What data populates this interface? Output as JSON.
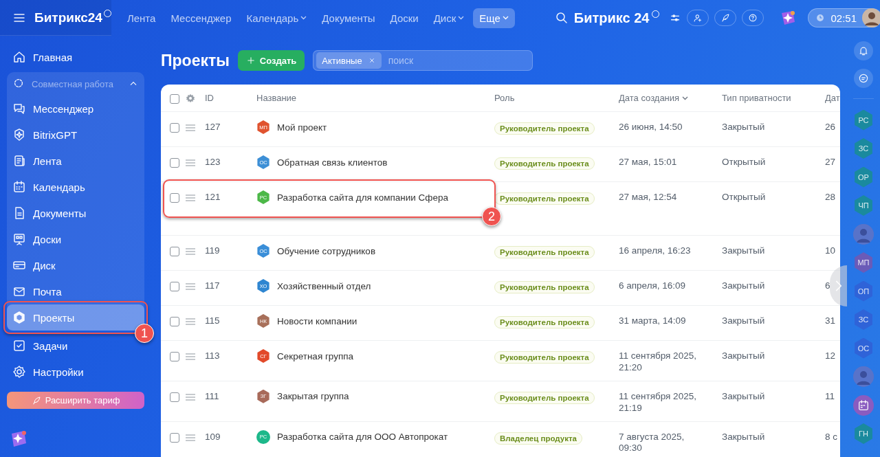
{
  "topbar": {
    "logo": "Битрикс24",
    "nav": [
      {
        "label": "Лента",
        "dropdown": false,
        "selected": false
      },
      {
        "label": "Мессенджер",
        "dropdown": false,
        "selected": false
      },
      {
        "label": "Календарь",
        "dropdown": true,
        "selected": false
      },
      {
        "label": "Документы",
        "dropdown": false,
        "selected": false
      },
      {
        "label": "Доски",
        "dropdown": false,
        "selected": false
      },
      {
        "label": "Диск",
        "dropdown": true,
        "selected": false
      },
      {
        "label": "Еще",
        "dropdown": true,
        "selected": true
      }
    ],
    "portal_title": "Битрикс 24",
    "time": "02:51"
  },
  "sidebar": {
    "top_items": [
      {
        "label": "Главная",
        "selected": false
      }
    ],
    "group": {
      "title": "Совместная работа",
      "expanded": true,
      "items": [
        {
          "label": "Мессенджер",
          "selected": false
        },
        {
          "label": "BitrixGPT",
          "selected": false
        },
        {
          "label": "Лента",
          "selected": false
        },
        {
          "label": "Календарь",
          "selected": false
        },
        {
          "label": "Документы",
          "selected": false
        },
        {
          "label": "Доски",
          "selected": false
        },
        {
          "label": "Диск",
          "selected": false
        },
        {
          "label": "Почта",
          "selected": false
        },
        {
          "label": "Проекты",
          "selected": true,
          "callout": "1"
        }
      ]
    },
    "bottom_items": [
      {
        "label": "Задачи",
        "selected": false
      },
      {
        "label": "Настройки",
        "selected": false
      }
    ],
    "upgrade_button": "Расширить тариф"
  },
  "page": {
    "title": "Проекты",
    "create_button": "Создать",
    "filter": {
      "chip": "Активные",
      "placeholder": "поиск"
    }
  },
  "table": {
    "header_checked": false,
    "columns": [
      {
        "label": "ID",
        "sorted": false
      },
      {
        "label": "Название",
        "sorted": false
      },
      {
        "label": "Роль",
        "sorted": false
      },
      {
        "label": "Дата создания",
        "sorted": true
      },
      {
        "label": "Тип приватности",
        "sorted": false
      },
      {
        "label": "Дат"
      }
    ],
    "rows": [
      {
        "checked": false,
        "id": "127",
        "kind": "hexagon",
        "initials": "МП",
        "color": "#e0532f",
        "name": "Мой проект",
        "role": "Руководитель проекта",
        "created": "26 июня, 14:50",
        "privacy": "Закрытый",
        "column_8": "26"
      },
      {
        "checked": false,
        "id": "123",
        "kind": "hexagon",
        "initials": "ОС",
        "color": "#3d8fd6",
        "name": "Обратная связь клиентов",
        "role": "Руководитель проекта",
        "created": "27 мая, 15:01",
        "privacy": "Открытый",
        "column_8": "27"
      },
      {
        "checked": false,
        "id": "121",
        "kind": "hexagon",
        "initials": "РС",
        "color": "#4cb848",
        "name": "Разработка сайта для компании Сфера",
        "role": "Руководитель проекта",
        "created": "27 мая, 12:54",
        "privacy": "Открытый",
        "column_8": "28",
        "callout": "2"
      },
      {
        "checked": false,
        "id": "119",
        "kind": "hexagon",
        "initials": "ОС",
        "color": "#3a8ed8",
        "name": "Обучение сотрудников",
        "role": "Руководитель проекта",
        "created": "16 апреля, 16:23",
        "privacy": "Закрытый",
        "column_8": "10"
      },
      {
        "checked": false,
        "id": "117",
        "kind": "hexagon",
        "initials": "ХО",
        "color": "#2f86d1",
        "name": "Хозяйственный отдел",
        "role": "Руководитель проекта",
        "created": "6 апреля, 16:09",
        "privacy": "Закрытый",
        "column_8": "6"
      },
      {
        "checked": false,
        "id": "115",
        "kind": "hexagon",
        "initials": "НК",
        "color": "#a8705a",
        "name": "Новости компании",
        "role": "Руководитель проекта",
        "created": "31 марта, 14:09",
        "privacy": "Закрытый",
        "column_8": "31"
      },
      {
        "checked": false,
        "id": "113",
        "kind": "hexagon",
        "initials": "СГ",
        "color": "#e24a2a",
        "name": "Секретная группа",
        "role": "Руководитель проекта",
        "created": "11 сентября 2025, 21:20",
        "privacy": "Закрытый",
        "column_8": "12"
      },
      {
        "checked": false,
        "id": "111",
        "kind": "hexagon",
        "initials": "ЗГ",
        "color": "#a86a5a",
        "name": "Закрытая группа",
        "role": "Руководитель проекта",
        "created": "11 сентября 2025, 21:19",
        "privacy": "Закрытый",
        "column_8": "11"
      },
      {
        "checked": false,
        "id": "109",
        "kind": "circle",
        "initials": "РС",
        "color": "#1db88a",
        "name": "Разработка сайта для ООО Автопрокат",
        "role": "Владелец продукта",
        "created": "7 августа 2025, 09:30",
        "privacy": "Закрытый",
        "column_8": "8 с"
      }
    ]
  },
  "rail": [
    {
      "kind": "bell"
    },
    {
      "kind": "chat"
    },
    {
      "kind": "hexagon",
      "initials": "РС",
      "color": "#1a8a9e"
    },
    {
      "kind": "hexagon",
      "initials": "ЗС",
      "color": "#1a8a9e"
    },
    {
      "kind": "hexagon",
      "initials": "ОР",
      "color": "#1a8a9e"
    },
    {
      "kind": "hexagon",
      "initials": "ЧП",
      "color": "#1a8a9e"
    },
    {
      "kind": "photo"
    },
    {
      "kind": "hexagon",
      "initials": "МП",
      "color": "#6a5bb8"
    },
    {
      "kind": "hexagon",
      "initials": "ОП",
      "color": "#2f63d8"
    },
    {
      "kind": "hexagon",
      "initials": "ЗС",
      "color": "#2f63d8"
    },
    {
      "kind": "hexagon",
      "initials": "ОС",
      "color": "#2f63d8"
    },
    {
      "kind": "photo"
    },
    {
      "kind": "calendar",
      "color": "#8a5cc0"
    },
    {
      "kind": "hexagon",
      "initials": "ГН",
      "color": "#1a8a9e"
    }
  ]
}
